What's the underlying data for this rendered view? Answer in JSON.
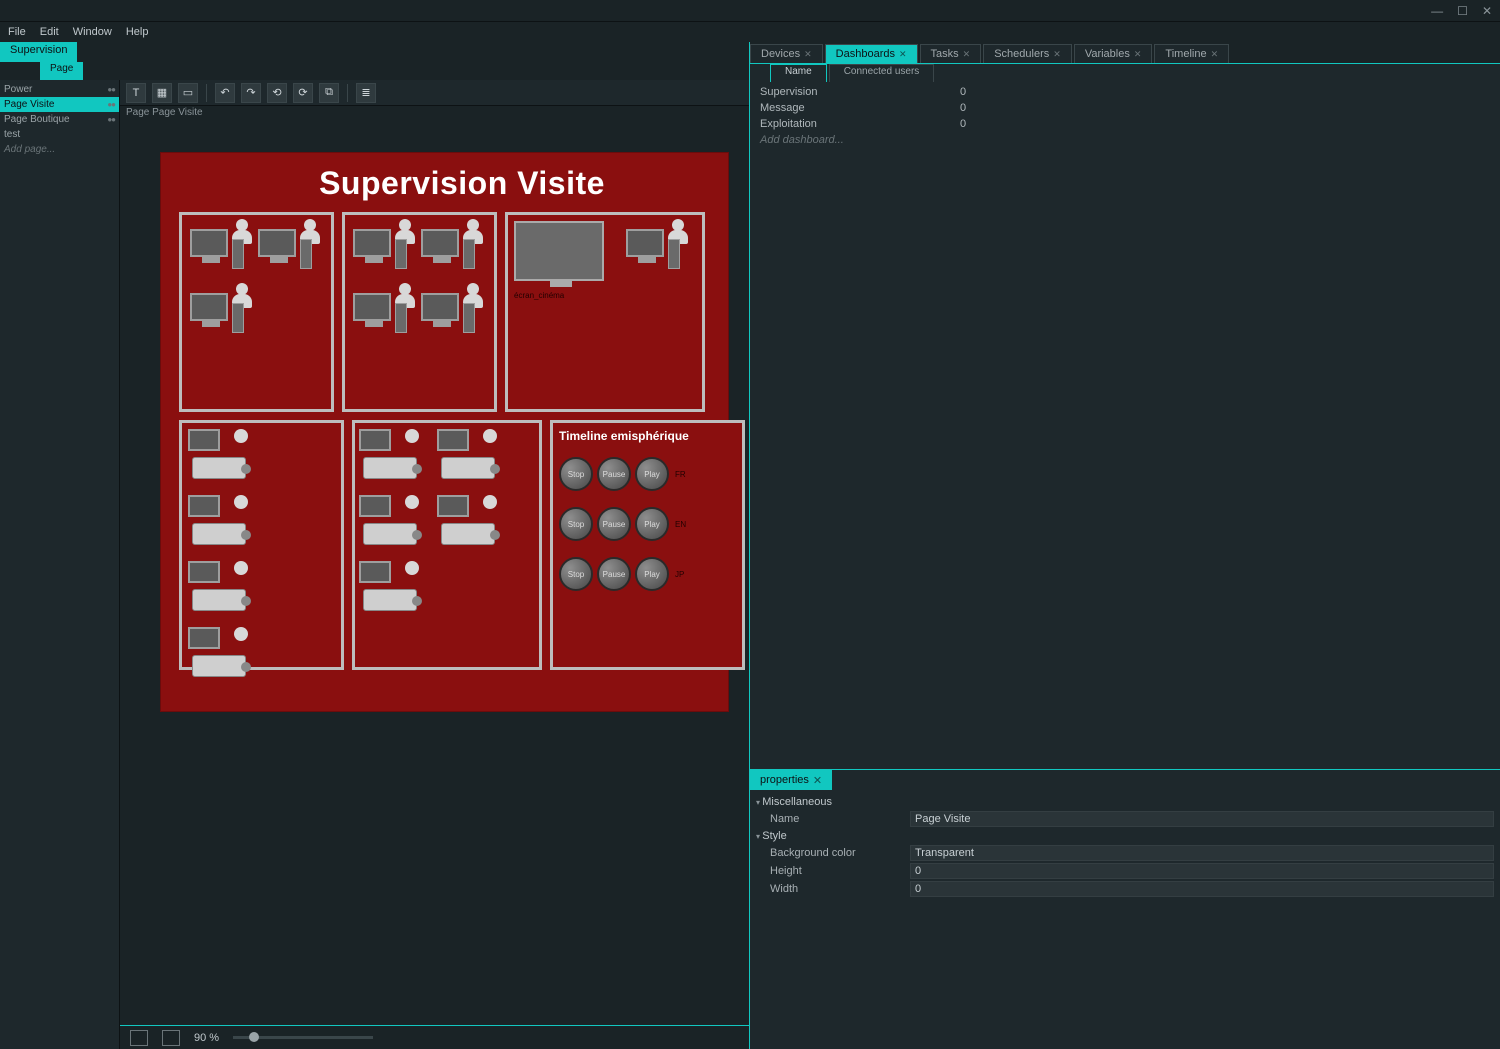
{
  "window_controls": {
    "minimize": "—",
    "maximize": "☐",
    "close": "✕"
  },
  "menubar": [
    "File",
    "Edit",
    "Window",
    "Help"
  ],
  "left": {
    "tabs": [
      "Supervision"
    ],
    "subtabs": [
      "Page"
    ],
    "pages": [
      {
        "label": "Power"
      },
      {
        "label": "Page Visite",
        "active": true
      },
      {
        "label": "Page Boutique"
      },
      {
        "label": "test"
      },
      {
        "label": "Add page...",
        "dim": true
      }
    ],
    "toolbar_icons": [
      "text-icon",
      "image-icon",
      "rect-icon",
      "undo-icon",
      "redo-icon",
      "rotate-left-icon",
      "rotate-right-icon",
      "group-icon",
      "layer-icon"
    ],
    "breadcrumb": "Page Page Visite"
  },
  "canvas": {
    "title": "Supervision Visite",
    "timeline_title": "Timeline emisphérique",
    "big_screen_label": "écran_cinéma",
    "tl_btn_labels": {
      "stop": "Stop",
      "pause": "Pause",
      "play": "Play"
    },
    "tl_row_labels": [
      "FR",
      "EN",
      "JP"
    ]
  },
  "statusbar": {
    "zoom": "90 %"
  },
  "right": {
    "tabs": [
      {
        "label": "Devices"
      },
      {
        "label": "Dashboards",
        "active": true
      },
      {
        "label": "Tasks"
      },
      {
        "label": "Schedulers"
      },
      {
        "label": "Variables"
      },
      {
        "label": "Timeline"
      }
    ],
    "subtabs": [
      {
        "label": "Name",
        "active": true
      },
      {
        "label": "Connected users"
      }
    ],
    "dashboards": [
      {
        "name": "Supervision",
        "count": "0"
      },
      {
        "name": "Message",
        "count": "0"
      },
      {
        "name": "Exploitation",
        "count": "0"
      },
      {
        "name": "Add dashboard...",
        "dim": true
      }
    ]
  },
  "props": {
    "tab": "properties",
    "groups": {
      "misc": {
        "label": "Miscellaneous",
        "rows": [
          {
            "k": "Name",
            "v": "Page Visite"
          }
        ]
      },
      "style": {
        "label": "Style",
        "rows": [
          {
            "k": "Background color",
            "v": "Transparent"
          },
          {
            "k": "Height",
            "v": "0"
          },
          {
            "k": "Width",
            "v": "0"
          }
        ]
      }
    }
  }
}
